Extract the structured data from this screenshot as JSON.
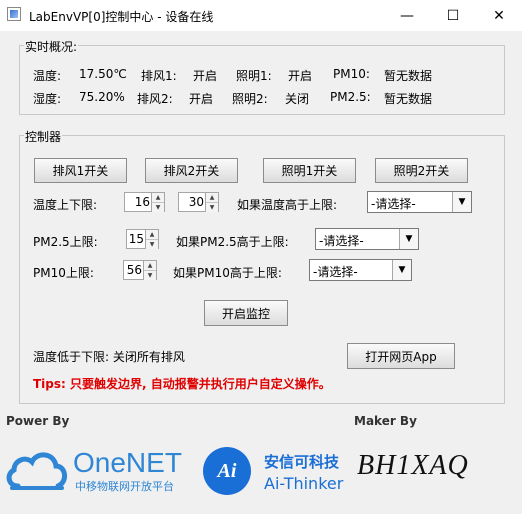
{
  "window": {
    "title": "LabEnvVP[0]控制中心 - 设备在线"
  },
  "overview": {
    "title": "实时概况:",
    "row1": [
      {
        "label": "温度:",
        "value": "17.50℃"
      },
      {
        "label": "排风1:",
        "value": "开启"
      },
      {
        "label": "照明1:",
        "value": "开启"
      },
      {
        "label": "PM10:",
        "value": "暂无数据"
      }
    ],
    "row2": [
      {
        "label": "湿度:",
        "value": "75.20%"
      },
      {
        "label": "排风2:",
        "value": "开启"
      },
      {
        "label": "照明2:",
        "value": "关闭"
      },
      {
        "label": "PM2.5:",
        "value": "暂无数据"
      }
    ]
  },
  "controls": {
    "title": "控制器",
    "buttons": [
      "排风1开关",
      "排风2开关",
      "照明1开关",
      "照明2开关"
    ],
    "temp": {
      "label": "温度上下限:",
      "low": "16",
      "high": "30",
      "if_label": "如果温度高于上限:",
      "select": "-请选择-"
    },
    "pm25": {
      "label": "PM2.5上限:",
      "value": "15",
      "if_label": "如果PM2.5高于上限:",
      "select": "-请选择-"
    },
    "pm10": {
      "label": "PM10上限:",
      "value": "56",
      "if_label": "如果PM10高于上限:",
      "select": "-请选择-"
    },
    "start_monitor": "开启监控",
    "below_lower": "温度低于下限: 关闭所有排风",
    "open_web": "打开网页App",
    "tips": "Tips: 只要触发边界, 自动报警并执行用户自定义操作。"
  },
  "footer": {
    "power_by": "Power By",
    "maker_by": "Maker By",
    "onenet": "OneNET",
    "onenet_sub": "中移物联网开放平台",
    "ai_cn": "安信可科技",
    "ai_en": "Ai-Thinker",
    "ai_badge": "Ai",
    "bh": "BH1XAQ"
  },
  "colors": {
    "tip": "#e00000",
    "onenet": "#2e86d5",
    "aithinker": "#1a6fd6"
  },
  "icons": [
    "app-icon",
    "minimize-icon",
    "maximize-icon",
    "close-icon",
    "cloud-icon",
    "chevron-down-icon"
  ]
}
